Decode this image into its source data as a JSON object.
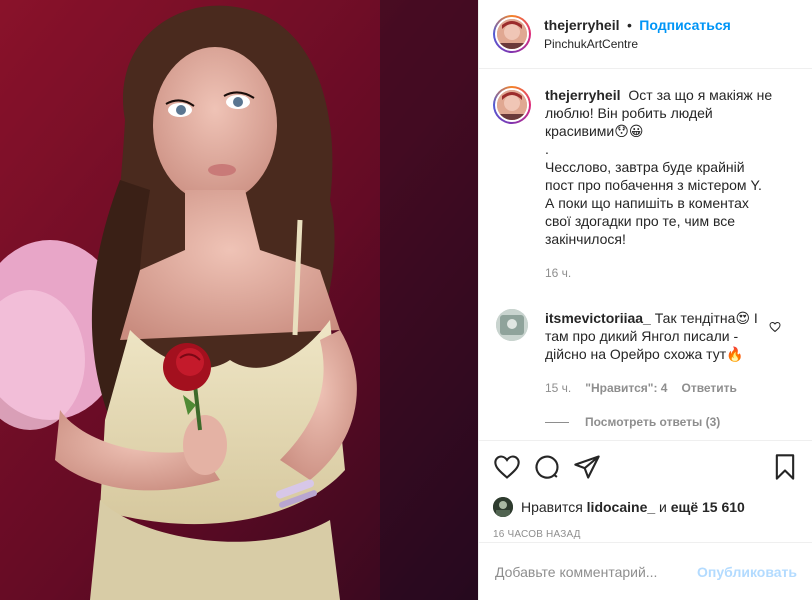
{
  "post": {
    "username": "thejerryheil",
    "follow_label": "Подписаться",
    "separator": "•",
    "location": "PinchukArtCentre",
    "caption": {
      "username": "thejerryheil",
      "line1": "Ост за що я макіяж не люблю! Він робить людей красивими😯😀",
      "line2": ".",
      "line3": "Чесслово, завтра буде крайній пост про побачення з містером Y. А поки що напишіть в коментах свої здогадки про те, чим все закінчилося!",
      "time": "16 ч."
    },
    "comments": [
      {
        "username": "itsmevictoriiaa_",
        "text": "Так тендітна😍 I там про дикий Янгол писали - дійсно на Орейро схожа тут🔥",
        "time": "15 ч.",
        "likes": "\"Нравится\": 4",
        "reply": "Ответить",
        "view_replies": "Посмотреть ответы (3)"
      }
    ],
    "likes": {
      "prefix": "Нравится",
      "user": "lidocaine_",
      "middle": "и",
      "rest": "ещё 15 610"
    },
    "date": "16 часов назад",
    "add_comment_placeholder": "Добавьте комментарий...",
    "post_button": "Опубликовать"
  },
  "icons": {
    "like": "heart-icon",
    "comment": "comment-icon",
    "share": "share-icon",
    "save": "bookmark-icon",
    "comment_like": "heart-icon"
  },
  "colors": {
    "link_blue": "#0095f6",
    "post_disabled": "#b3dbff",
    "muted": "#8e8e8e",
    "text": "#262626"
  }
}
